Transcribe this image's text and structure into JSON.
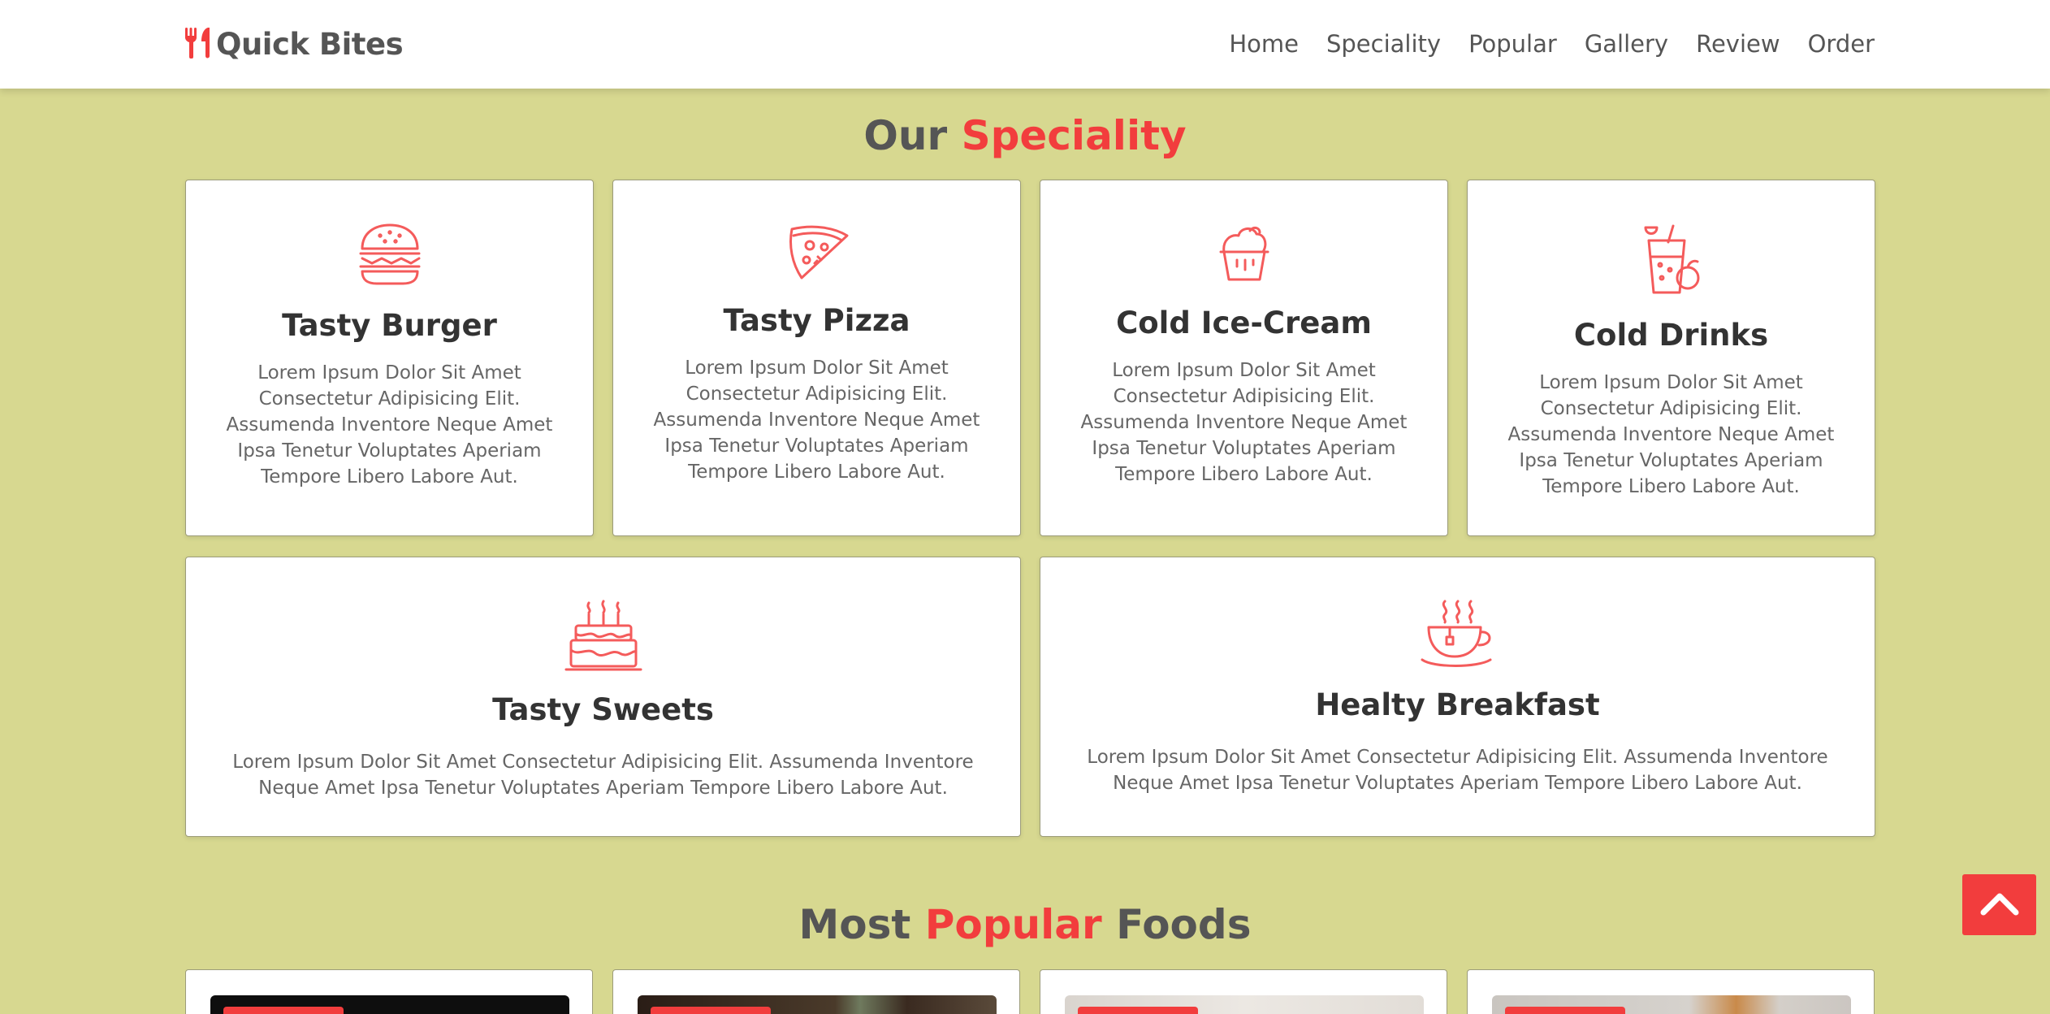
{
  "header": {
    "logo_text": "Quick Bites",
    "nav": [
      "Home",
      "Speciality",
      "Popular",
      "Gallery",
      "Review",
      "Order"
    ]
  },
  "speciality": {
    "title_part1": "Our",
    "title_accent": "Speciality",
    "cards": [
      {
        "icon": "burger-icon",
        "title": "Tasty Burger",
        "text": "Lorem Ipsum Dolor Sit Amet Consectetur Adipisicing Elit. Assumenda Inventore Neque Amet Ipsa Tenetur Voluptates Aperiam Tempore Libero Labore Aut."
      },
      {
        "icon": "pizza-icon",
        "title": "Tasty Pizza",
        "text": "Lorem Ipsum Dolor Sit Amet Consectetur Adipisicing Elit. Assumenda Inventore Neque Amet Ipsa Tenetur Voluptates Aperiam Tempore Libero Labore Aut."
      },
      {
        "icon": "ice-cream-icon",
        "title": "Cold Ice-Cream",
        "text": "Lorem Ipsum Dolor Sit Amet Consectetur Adipisicing Elit. Assumenda Inventore Neque Amet Ipsa Tenetur Voluptates Aperiam Tempore Libero Labore Aut."
      },
      {
        "icon": "drink-icon",
        "title": "Cold Drinks",
        "text": "Lorem Ipsum Dolor Sit Amet Consectetur Adipisicing Elit. Assumenda Inventore Neque Amet Ipsa Tenetur Voluptates Aperiam Tempore Libero Labore Aut."
      },
      {
        "icon": "cake-icon",
        "title": "Tasty Sweets",
        "text": "Lorem Ipsum Dolor Sit Amet Consectetur Adipisicing Elit. Assumenda Inventore Neque Amet Ipsa Tenetur Voluptates Aperiam Tempore Libero Labore Aut."
      },
      {
        "icon": "tea-cup-icon",
        "title": "Healty Breakfast",
        "text": "Lorem Ipsum Dolor Sit Amet Consectetur Adipisicing Elit. Assumenda Inventore Neque Amet Ipsa Tenetur Voluptates Aperiam Tempore Libero Labore Aut."
      }
    ]
  },
  "popular": {
    "title_part1": "Most",
    "title_accent": "Popular",
    "title_part2": "Foods"
  },
  "colors": {
    "accent": "#f23d3d",
    "background": "#d7d890",
    "text": "#555555"
  },
  "scroll_top_icon": "chevron-up-icon"
}
